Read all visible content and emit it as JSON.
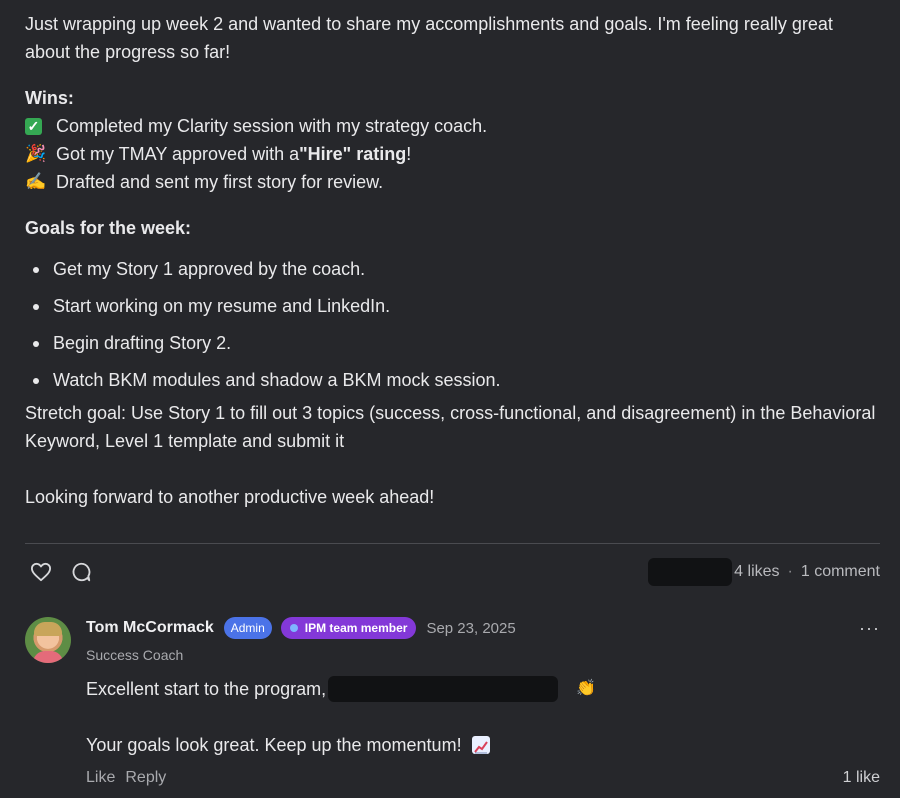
{
  "post": {
    "intro": "Just wrapping up week 2 and wanted to share my accomplishments and goals. I'm feeling really great about the progress so far!",
    "wins_title": "Wins:",
    "wins": [
      {
        "icon": "✅",
        "text": "Completed my Clarity session with my strategy coach."
      },
      {
        "icon": "🎉",
        "pre": "Got my TMAY approved with a ",
        "bold": "\"Hire\" rating",
        "post": "!"
      },
      {
        "icon": "✍️",
        "text": "Drafted and sent my first story for review."
      }
    ],
    "goals_title": "Goals for the week:",
    "goals": [
      "Get my Story 1 approved by the coach.",
      "Start working on my resume and LinkedIn.",
      "Begin drafting Story 2.",
      "Watch BKM modules and shadow a BKM mock session."
    ],
    "stretch": "Stretch goal: Use Story 1 to fill out 3 topics (success, cross-functional, and disagreement) in the Behavioral Keyword, Level 1 template and submit it",
    "outro": "Looking forward to another productive week ahead!"
  },
  "stats": {
    "likes": "4 likes",
    "separator": "·",
    "comments": "1 comment"
  },
  "comment": {
    "author": "Tom McCormack",
    "badge_admin": "Admin",
    "badge_team": "IPM team member",
    "date": "Sep 23, 2025",
    "role": "Success Coach",
    "line1": "Excellent start to the program,",
    "clap": "👏",
    "line2": "Your goals look great. Keep up the momentum!",
    "like_label": "Like",
    "reply_label": "Reply",
    "likes": "1 like"
  },
  "colors": {
    "background": "#26272b",
    "admin_badge": "#4b73e8",
    "team_badge": "#8338d8"
  },
  "icons": {
    "like": "heart-icon",
    "comment": "comment-bubble-icon",
    "more": "more-dots-icon"
  }
}
